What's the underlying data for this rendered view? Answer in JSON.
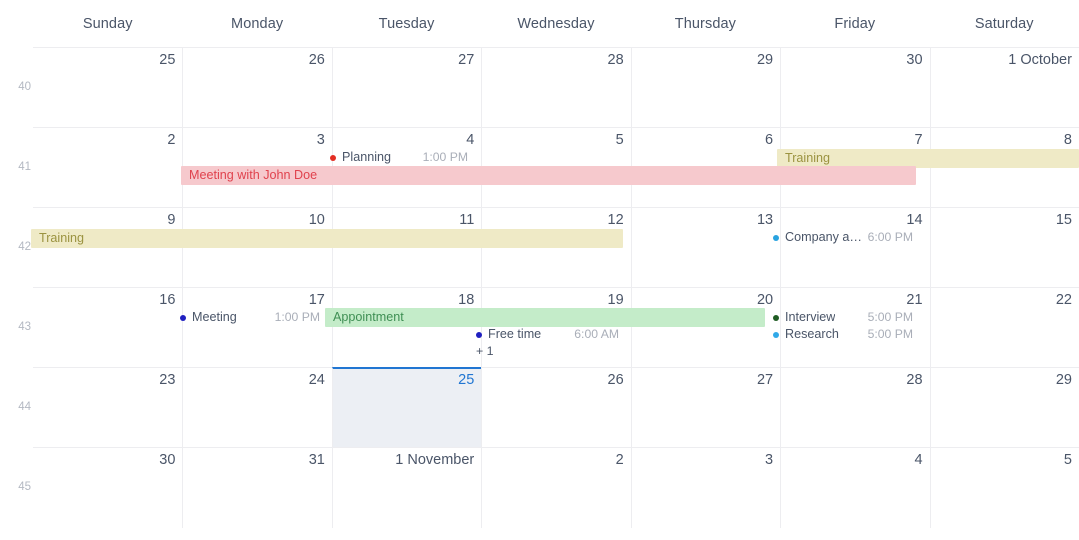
{
  "calendar": {
    "weekdays": [
      "Sunday",
      "Monday",
      "Tuesday",
      "Wednesday",
      "Thursday",
      "Friday",
      "Saturday"
    ],
    "week_numbers": [
      "40",
      "41",
      "42",
      "43",
      "44",
      "45"
    ],
    "colors": {
      "grid_line": "#ededf0",
      "day_text": "#4a5568",
      "week_number_text": "#b3b8c2",
      "selected_background": "#eceff4",
      "selected_border": "#2176d2",
      "selected_text": "#2176d2",
      "event_pink_bg": "#f6c9cd",
      "event_pink_text": "#e0424d",
      "event_yellow_bg": "#efeac6",
      "event_yellow_text": "#9b9340",
      "event_green_bg": "#c4ecc9",
      "event_green_text": "#3f8f54",
      "dot_red": "#e32e23",
      "dot_blue": "#29a3e0",
      "dot_navy": "#2020c0",
      "dot_darkgreen": "#1f5c23",
      "dot_lightblue": "#31a9e8",
      "time_text": "#a9aeb8"
    },
    "weeks": [
      {
        "number": "40",
        "days": [
          {
            "label": "25",
            "selected": false
          },
          {
            "label": "26",
            "selected": false
          },
          {
            "label": "27",
            "selected": false
          },
          {
            "label": "28",
            "selected": false
          },
          {
            "label": "29",
            "selected": false
          },
          {
            "label": "30",
            "selected": false
          },
          {
            "label": "1 October",
            "selected": false
          }
        ]
      },
      {
        "number": "41",
        "days": [
          {
            "label": "2",
            "selected": false
          },
          {
            "label": "3",
            "selected": false
          },
          {
            "label": "4",
            "selected": false
          },
          {
            "label": "5",
            "selected": false
          },
          {
            "label": "6",
            "selected": false
          },
          {
            "label": "7",
            "selected": false
          },
          {
            "label": "8",
            "selected": false
          }
        ]
      },
      {
        "number": "42",
        "days": [
          {
            "label": "9",
            "selected": false
          },
          {
            "label": "10",
            "selected": false
          },
          {
            "label": "11",
            "selected": false
          },
          {
            "label": "12",
            "selected": false
          },
          {
            "label": "13",
            "selected": false
          },
          {
            "label": "14",
            "selected": false
          },
          {
            "label": "15",
            "selected": false
          }
        ]
      },
      {
        "number": "43",
        "days": [
          {
            "label": "16",
            "selected": false
          },
          {
            "label": "17",
            "selected": false
          },
          {
            "label": "18",
            "selected": false
          },
          {
            "label": "19",
            "selected": false
          },
          {
            "label": "20",
            "selected": false
          },
          {
            "label": "21",
            "selected": false
          },
          {
            "label": "22",
            "selected": false
          }
        ]
      },
      {
        "number": "44",
        "days": [
          {
            "label": "23",
            "selected": false
          },
          {
            "label": "24",
            "selected": false
          },
          {
            "label": "25",
            "selected": true
          },
          {
            "label": "26",
            "selected": false
          },
          {
            "label": "27",
            "selected": false
          },
          {
            "label": "28",
            "selected": false
          },
          {
            "label": "29",
            "selected": false
          }
        ]
      },
      {
        "number": "45",
        "days": [
          {
            "label": "30",
            "selected": false
          },
          {
            "label": "31",
            "selected": false
          },
          {
            "label": "1 November",
            "selected": false
          },
          {
            "label": "2",
            "selected": false
          },
          {
            "label": "3",
            "selected": false
          },
          {
            "label": "4",
            "selected": false
          },
          {
            "label": "5",
            "selected": false
          }
        ]
      }
    ],
    "events": {
      "planning": {
        "title": "Planning",
        "time": "1:00 PM"
      },
      "meeting_john_doe": {
        "title": "Meeting with John Doe"
      },
      "training_week41": {
        "title": "Training"
      },
      "training_week42": {
        "title": "Training"
      },
      "company_activity": {
        "title": "Company acti...",
        "time": "6:00 PM"
      },
      "meeting": {
        "title": "Meeting",
        "time": "1:00 PM"
      },
      "appointment": {
        "title": "Appointment"
      },
      "free_time": {
        "title": "Free time",
        "time": "6:00 AM"
      },
      "more_one": {
        "label": "+ 1"
      },
      "interview": {
        "title": "Interview",
        "time": "5:00 PM"
      },
      "research": {
        "title": "Research",
        "time": "5:00 PM"
      }
    }
  }
}
